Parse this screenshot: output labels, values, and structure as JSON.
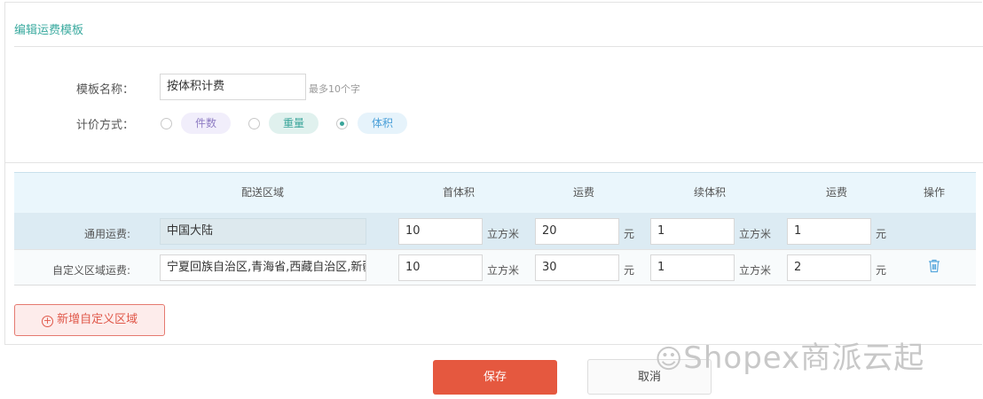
{
  "title": "编辑运费模板",
  "form": {
    "name_label": "模板名称：",
    "name_value": "按体积计费",
    "name_hint": "最多10个字",
    "method_label": "计价方式：",
    "methods": [
      {
        "label": "件数",
        "selected": false
      },
      {
        "label": "重量",
        "selected": false
      },
      {
        "label": "体积",
        "selected": true
      }
    ]
  },
  "table": {
    "headers": [
      "配送区域",
      "首体积",
      "运费",
      "续体积",
      "运费",
      "操作"
    ],
    "rows": [
      {
        "label": "通用运费:",
        "area": "中国大陆",
        "first": "10",
        "first_unit": "立方米",
        "fee": "20",
        "fee_unit": "元",
        "next": "1",
        "next_unit": "立方米",
        "next_fee": "1",
        "next_fee_unit": "元"
      },
      {
        "label": "自定义区域运费:",
        "area": "宁夏回族自治区,青海省,西藏自治区,新疆维吾尔自治区",
        "first": "10",
        "first_unit": "立方米",
        "fee": "30",
        "fee_unit": "元",
        "next": "1",
        "next_unit": "立方米",
        "next_fee": "2",
        "next_fee_unit": "元",
        "action_icon": "trash-icon"
      }
    ]
  },
  "add_button": "新增自定义区域",
  "save_button": "保存",
  "cancel_button": "取消",
  "watermark": "Shopex商派云起",
  "colors": {
    "accent": "#3aaa9f",
    "save": "#e5583f",
    "add": "#e0584a"
  }
}
